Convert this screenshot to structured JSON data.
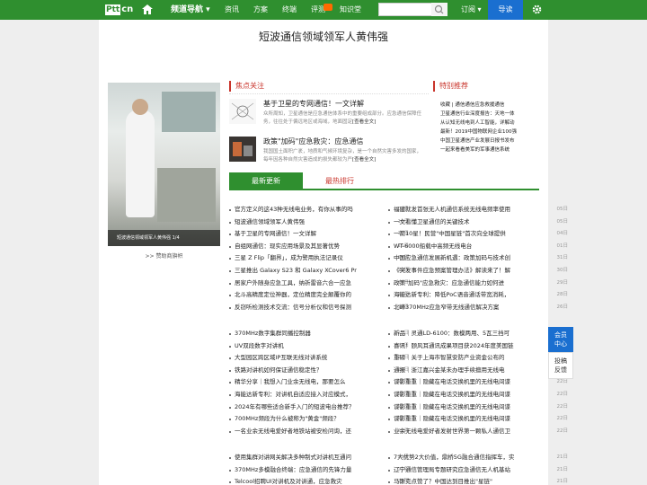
{
  "header": {
    "logo_text": "Ptt",
    "logo_suffix": "cn",
    "channel_nav": "频道导航 ▾",
    "nav_items": [
      "资讯",
      "方案",
      "终端",
      "评测",
      "知识堂"
    ],
    "subscribe": "订阅 ▾",
    "guide": "导读"
  },
  "article_title": "短波通信领域领军人黄伟强",
  "photo_caption": "短波通信领域领军人黄伟强 1/4",
  "sponsor": ">> 赞助商旗帜",
  "focus": {
    "heading": "焦点关注",
    "items": [
      {
        "title": "基于卫星的专网通信！一文详解",
        "desc": "众所周知，卫星通信是应急通信体系中的重要组成部分。应急通信保障任务，往往处于偏远地区或海域，地面固定",
        "more": "[查看全文]"
      },
      {
        "title": "政策\"加码\"应急救灾：应急通信",
        "desc": "我国国土面积广袤，地质和气候环境复杂，是一个自然灾害多发的国家，每年因各种自然灾害造成的损失都较为严",
        "more": "[查看全文]"
      }
    ]
  },
  "recommend": {
    "heading": "特别推荐",
    "items": [
      "收藏 | 通信通信应急救援通信",
      "卫星通信行业深度报告：天地一体",
      "从认知无线电到人工智能，详解动",
      "最新！2019中国物联网企业100强",
      "中国卫星通信产业发展日报书发布",
      "一起来看看美军的军事通信系统"
    ]
  },
  "tabs": {
    "latest": "最新更新",
    "hot": "最热排行"
  },
  "lists": {
    "block1_left": [
      {
        "t": "官方定义的这43种无线电业务，有你从事的吗",
        "d": "07日"
      },
      {
        "t": "短波通信领域领军人黄伟强",
        "d": "16日"
      },
      {
        "t": "基于卫星的专网通信！一文详解",
        "d": "16日"
      },
      {
        "t": "自组网通信：现实应用场景及其显著优势",
        "d": "15日"
      },
      {
        "t": "三星 Z Flip「翻界」，成为警用执法记录仪",
        "d": "15日"
      },
      {
        "t": "三星推出 Galaxy S23 和 Galaxy XCover6 Pr",
        "d": "14日"
      },
      {
        "t": "居家户外随身应急工具，纳祈雷音六合一应急",
        "d": "13日"
      },
      {
        "t": "北斗高精度定位神器，定位精度完全颠覆你的",
        "d": "12日"
      },
      {
        "t": "反窃听检测技术交流：信号分析仪和信号探测",
        "d": "11日"
      }
    ],
    "block1_right": [
      {
        "t": "福建就发首张无人机通信系统无线电频率使用",
        "d": "05日"
      },
      {
        "t": "一文看懂卫星通信的关键技术",
        "d": "05日"
      },
      {
        "t": "一箭10星！民营\"中国星链\"首次向全球提供",
        "d": "04日"
      },
      {
        "t": "WT-6000船载中高频无线电台",
        "d": "01日"
      },
      {
        "t": "中国应急通信发展新机遇：政策加码与技术创",
        "d": "31日"
      },
      {
        "t": "《突发事件应急预案管理办法》解读来了！解",
        "d": "30日"
      },
      {
        "t": "政策\"加码\"应急救灾：应急通信能力如何进",
        "d": "29日"
      },
      {
        "t": "海能达新专利：降低PoC语音通话带宽消耗，",
        "d": "28日"
      },
      {
        "t": "北峰370MHz应急窄带无线通信解决方案",
        "d": "26日"
      }
    ],
    "block2_left": [
      {
        "t": "370MHz数字集群同播控制器",
        "d": "23日"
      },
      {
        "t": "UV双段数字对讲机",
        "d": "23日"
      },
      {
        "t": "大型园区跨区域IP互联无线对讲系统",
        "d": "23日"
      },
      {
        "t": "铁路对讲机如何保证通信稳定性？",
        "d": "22日"
      },
      {
        "t": "精华分享｜我想入门业余无线电，那要怎么",
        "d": "22日"
      },
      {
        "t": "海能达新专利：对讲机自适应接入对应模式，",
        "d": "22日"
      },
      {
        "t": "2024年有哪些适合新手入门的短波电台推荐？",
        "d": "22日"
      },
      {
        "t": "700MHz频段为什么被称为\"黄金\"频段？",
        "d": "22日"
      },
      {
        "t": "一名业余无线电爱好者地铁站被安检问询，还",
        "d": "22日"
      }
    ],
    "block2_right": [
      {
        "t": "新品｜灵通LD-6100：数模两用、5瓦三挡可",
        "d": "22日"
      },
      {
        "t": "喜讯！颐风耳通讯成果项目获2024年度美国链",
        "d": "22日"
      },
      {
        "t": "重磅｜关于上海市智慧安防产业资金公布的",
        "d": "22日"
      },
      {
        "t": "通报｜浙江嘉兴金某未办理手续擅用无线电",
        "d": "22日"
      },
      {
        "t": "谍影重重｜隐藏在电话交换机里的无线电间谍",
        "d": "22日"
      },
      {
        "t": "谍影重重｜隐藏在电话交换机里的无线电间谍",
        "d": "22日"
      },
      {
        "t": "谍影重重｜隐藏在电话交换机里的无线电间谍",
        "d": "22日"
      },
      {
        "t": "谍影重重｜隐藏在电话交换机里的无线电间谍",
        "d": "22日"
      },
      {
        "t": "业余无线电爱好者发射世界第一颗私人通信卫",
        "d": "22日"
      }
    ],
    "block3_left": [
      {
        "t": "使用集群对讲网关解决多种制式对讲机互通问",
        "d": "21日"
      },
      {
        "t": "370MHz多模融合终端：应急通信的先锋力量",
        "d": "21日"
      },
      {
        "t": "Telcool招聘UI对讲机及对讲通，应急救灾",
        "d": "21日"
      }
    ],
    "block3_right": [
      {
        "t": "7大优势2大价值，鼎桥5G融合通信指挥车，实",
        "d": "21日"
      },
      {
        "t": "辽宁通信管理局专题研究应急通信无人机基站",
        "d": "21日"
      },
      {
        "t": "马斯克点赞了？中国达到目推出\"星链\"",
        "d": "21日"
      }
    ]
  },
  "side": {
    "member": [
      "会员",
      "中心"
    ],
    "feedback": [
      "投稿",
      "反馈"
    ]
  }
}
